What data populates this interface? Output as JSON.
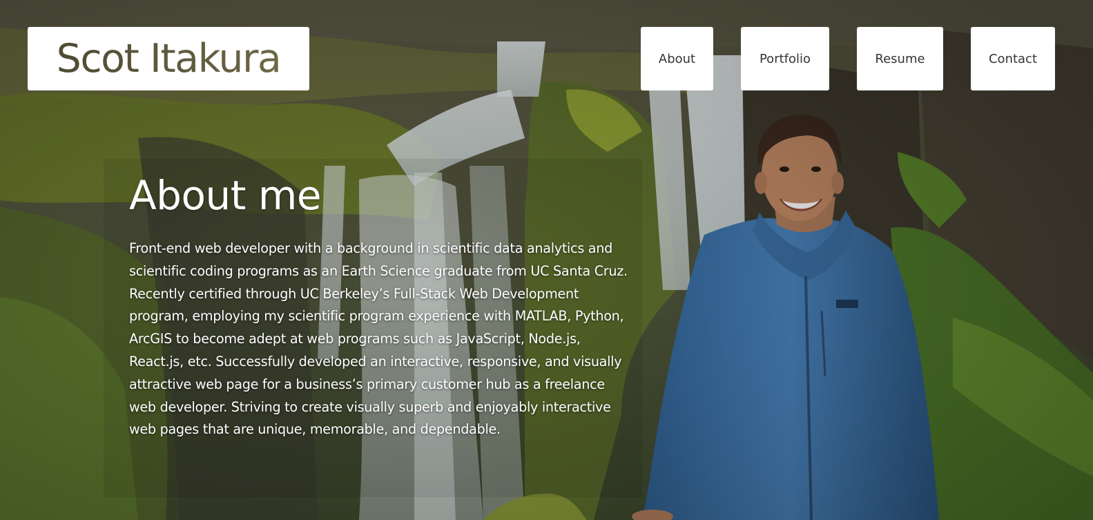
{
  "header": {
    "brand": "Scot Itakura"
  },
  "nav": {
    "about": "About",
    "portfolio": "Portfolio",
    "resume": "Resume",
    "contact": "Contact"
  },
  "about": {
    "title": "About me",
    "body": "Front-end web developer with a background in scientific data analytics and scientific coding programs as an Earth Science graduate from UC Santa Cruz. Recently certified through UC Berkeley’s Full-Stack Web Development program, employing my scientific program experience with MATLAB, Python, ArcGIS to become adept at web programs such as JavaScript, Node.js, React.js, etc. Successfully developed an interactive, responsive, and visually attractive web page for a business’s primary customer hub as a freelance web developer. Striving to create visually superb and enjoyably interactive web pages that are unique, memorable, and dependable."
  },
  "colors": {
    "brand_text": "#5a563a",
    "nav_text": "#333333",
    "card_background": "#ffffff",
    "jacket": "#3f76ad"
  },
  "background": {
    "subject": "person-in-blue-jacket-at-waterfall"
  }
}
